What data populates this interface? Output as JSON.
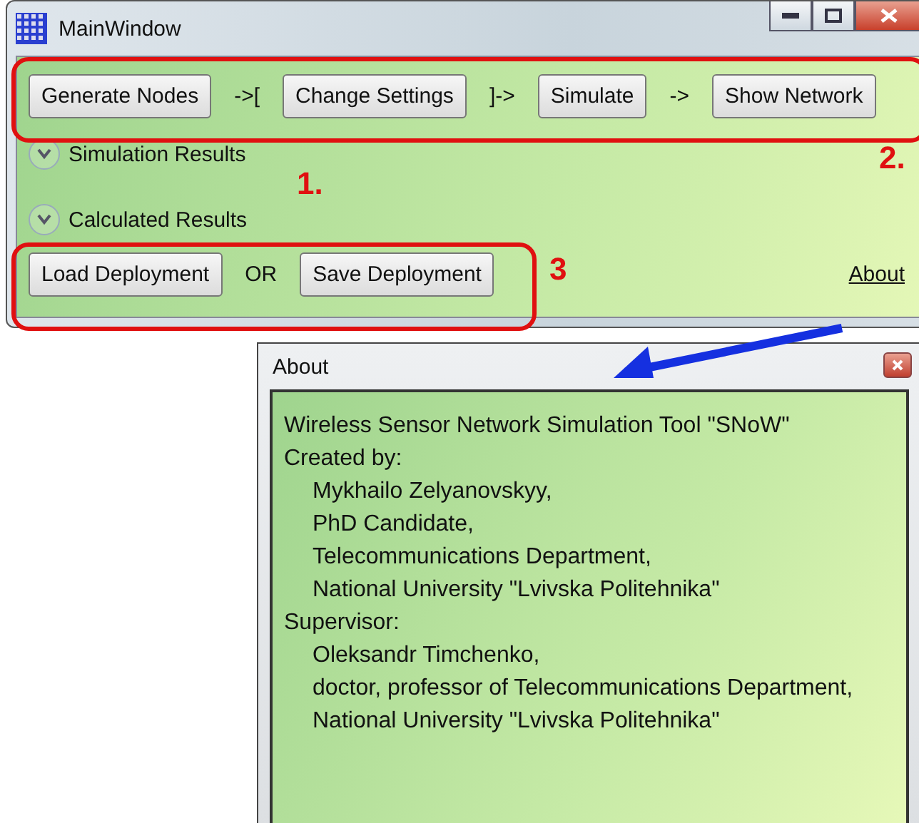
{
  "main_window": {
    "title": "MainWindow",
    "toolbar": [
      {
        "kind": "button",
        "label": "Generate Nodes"
      },
      {
        "kind": "text",
        "label": "->["
      },
      {
        "kind": "button",
        "label": "Change Settings"
      },
      {
        "kind": "text",
        "label": "]->"
      },
      {
        "kind": "button",
        "label": "Simulate"
      },
      {
        "kind": "text",
        "label": "->"
      },
      {
        "kind": "button",
        "label": "Show Network"
      }
    ],
    "expanders": [
      {
        "label": "Simulation Results",
        "expanded": false
      },
      {
        "label": "Calculated Results",
        "expanded": false
      }
    ],
    "bottom_bar": [
      {
        "kind": "button",
        "label": "Load Deployment"
      },
      {
        "kind": "text",
        "label": "OR"
      },
      {
        "kind": "button",
        "label": "Save Deployment"
      }
    ],
    "about_link": "About"
  },
  "annotations": [
    {
      "label": "1."
    },
    {
      "label": "2."
    },
    {
      "label": "3"
    }
  ],
  "about_dialog": {
    "title": "About",
    "lines": [
      {
        "text": "Wireless Sensor Network Simulation Tool \"SNoW\"",
        "indented": false
      },
      {
        "text": "Created by:",
        "indented": false
      },
      {
        "text": "Mykhailo Zelyanovskyy,",
        "indented": true
      },
      {
        "text": "PhD Candidate,",
        "indented": true
      },
      {
        "text": "Telecommunications Department,",
        "indented": true
      },
      {
        "text": "National University \"Lvivska Politehnika\"",
        "indented": true
      },
      {
        "text": "Supervisor:",
        "indented": false
      },
      {
        "text": "Oleksandr Timchenko,",
        "indented": true
      },
      {
        "text": "doctor, professor of Telecommunications Department,",
        "indented": true
      },
      {
        "text": "National University \"Lvivska Politehnika\"",
        "indented": true
      }
    ]
  }
}
